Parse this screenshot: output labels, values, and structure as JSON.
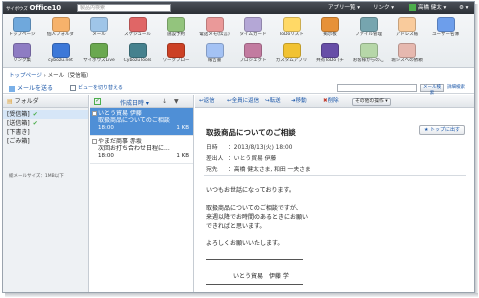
{
  "topbar": {
    "logo_brand": "サイボウズ",
    "logo_product": "Office10",
    "search_placeholder": "製品内検索",
    "app_menu": "アプリ一覧 ▾",
    "links_menu": "リンク ▾",
    "user_name": "高橋 健太 ▾",
    "settings": "⚙ ▾"
  },
  "apps": [
    {
      "label": "トップページ",
      "color": "#6fa8dc"
    },
    {
      "label": "個人フォルダ",
      "color": "#f6b26b"
    },
    {
      "label": "メール",
      "color": "#9fc5e8"
    },
    {
      "label": "スケジュール",
      "color": "#e06666"
    },
    {
      "label": "施設予約",
      "color": "#93c47d"
    },
    {
      "label": "電話メモ(伝言)",
      "color": "#ea9999"
    },
    {
      "label": "タイムカード",
      "color": "#b4a7d6"
    },
    {
      "label": "ToDoリスト",
      "color": "#ffd966"
    },
    {
      "label": "掲示板",
      "color": "#e69138"
    },
    {
      "label": "ファイル管理",
      "color": "#76a5af"
    },
    {
      "label": "アドレス帳",
      "color": "#f9cb9c"
    },
    {
      "label": "ユーザー名簿",
      "color": "#6d9eeb"
    },
    {
      "label": "リンク集",
      "color": "#8e7cc3"
    },
    {
      "label": "cybozu.net",
      "color": "#3c78d8"
    },
    {
      "label": "サイボウズLive",
      "color": "#6aa84f"
    },
    {
      "label": "CybozuTools",
      "color": "#45818e"
    },
    {
      "label": "ワークフロー",
      "color": "#cc4125"
    },
    {
      "label": "報告書",
      "color": "#a4c2f4"
    },
    {
      "label": "プロジェクト",
      "color": "#c27ba0"
    },
    {
      "label": "カスタムアプリ",
      "color": "#f1c232"
    },
    {
      "label": "共有ToDo (チ",
      "color": "#674ea7"
    },
    {
      "label": "お客様からのご",
      "color": "#b6d7a8"
    },
    {
      "label": "堀シスへの依頼",
      "color": "#e6b8af"
    }
  ],
  "breadcrumb": {
    "home": "トップページ",
    "sep": "›",
    "current": "メール（受信箱）"
  },
  "toolbar": {
    "send": "メールを送る",
    "view_toggle": "ビューを切り替える",
    "search_button": "メール検索",
    "detail_search": "詳細検索"
  },
  "folders": {
    "header": "フォルダ",
    "items": [
      {
        "label": "[受信箱]",
        "check": "✔"
      },
      {
        "label": "[送信箱]",
        "check": "✔"
      },
      {
        "label": "[下書き]",
        "check": ""
      },
      {
        "label": "[ごみ箱]",
        "check": ""
      }
    ],
    "mail_size": "総メールサイズ：1MB以下"
  },
  "list": {
    "sort_label": "作成日時 ▾",
    "messages": [
      {
        "from": "いとう貿易 伊藤",
        "subject": "取扱商品についてのご相談",
        "date": "18:00",
        "size": "1 KB",
        "selected": true
      },
      {
        "from": "やまだ商事 赤坂",
        "subject": "次回お打ち合わせ日程に...",
        "date": "18:00",
        "size": "1 KB",
        "selected": false
      }
    ]
  },
  "reader": {
    "tools": {
      "reply": "返信",
      "reply_all": "全員に返信",
      "forward": "転送",
      "move": "移動",
      "delete": "削除",
      "other_ops": "その他の操作 ▾"
    },
    "to_top": "★ トップに出す",
    "subject": "取扱商品についてのご相談",
    "date_label": "日時",
    "date_value": "：2013/8/13(火) 18:00",
    "from_label": "差出人",
    "from_value": "：いとう貿易 伊藤",
    "to_label": "宛先",
    "to_value": "：高橋 健太さま, 和田 一夫さま",
    "body_lines": [
      "いつもお世話になっております。",
      "",
      "取扱商品についてのご相談ですが、",
      "来週以降でお時間のあるときにお願い",
      "できればと思います。",
      "",
      "よろしくお願いいたします。"
    ],
    "signature": "いとう貿易　伊藤 学"
  }
}
